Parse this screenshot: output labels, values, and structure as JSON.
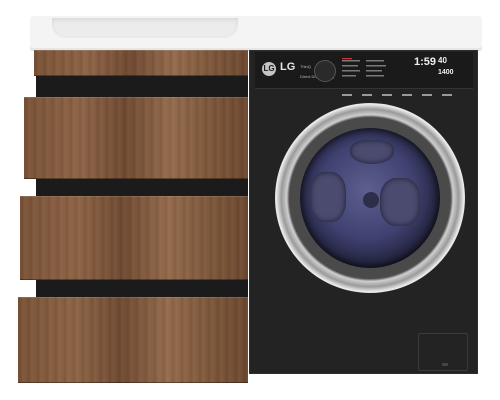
{
  "washer": {
    "brand": "LG",
    "logo_letters": "LG",
    "sub_brand": "ThinQ",
    "model_caption": "Direct Drive 10.5kg",
    "display_time": "1:59",
    "display_temp": "40",
    "display_spin": "1400"
  },
  "colors": {
    "wood": "#7a5236",
    "washer_body": "#232323",
    "countertop": "#f4f4f4",
    "drum_glass": "#3f4170"
  }
}
